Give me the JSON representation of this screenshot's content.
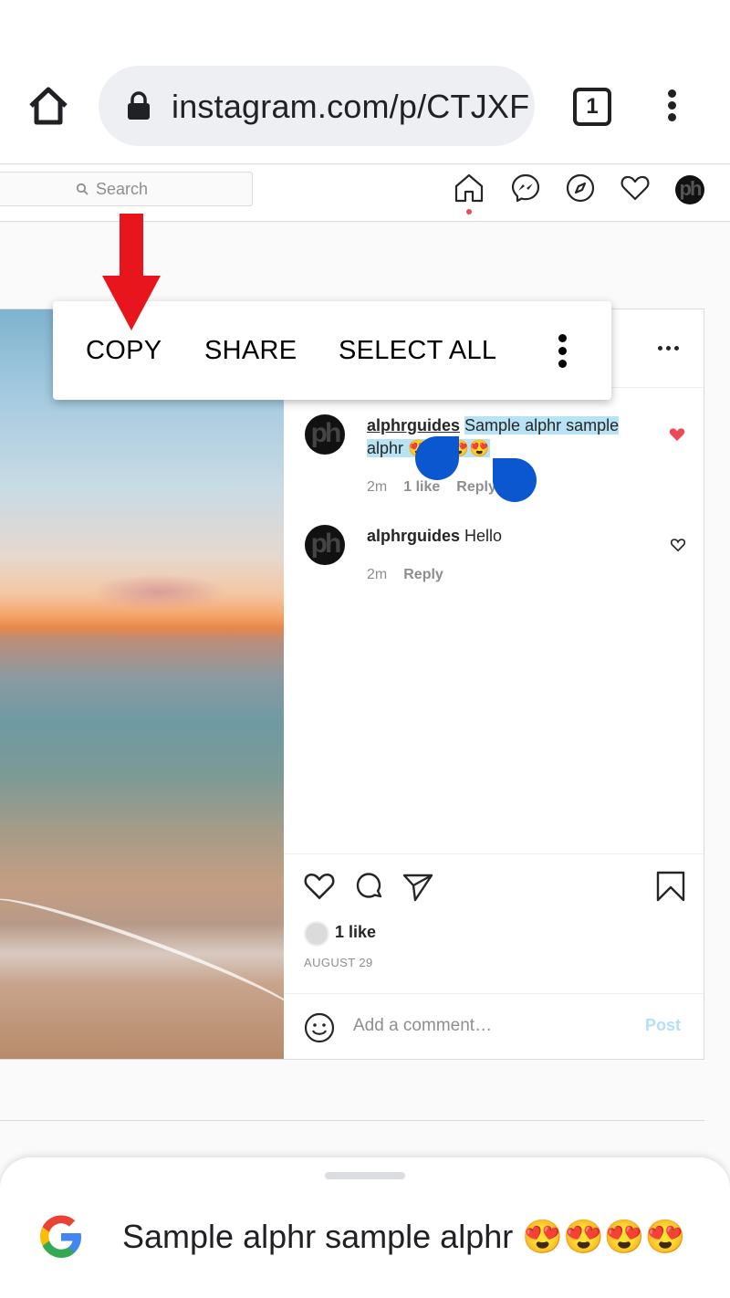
{
  "browser": {
    "url": "instagram.com/p/CTJXF",
    "tab_count": "1"
  },
  "ig_nav": {
    "search_placeholder": "Search",
    "avatar_text": "ph"
  },
  "context_menu": {
    "copy": "COPY",
    "share": "SHARE",
    "select_all": "SELECT ALL"
  },
  "comments": [
    {
      "avatar_text": "ph",
      "username": "alphrguides",
      "text_line1": "Sample alphr sample",
      "text_line2": "alphr 😍😍😍😍",
      "time": "2m",
      "likes": "1 like",
      "reply": "Reply",
      "liked": true
    },
    {
      "avatar_text": "ph",
      "username": "alphrguides",
      "text": "Hello",
      "time": "2m",
      "reply": "Reply",
      "liked": false
    }
  ],
  "post": {
    "likes": "1 like",
    "date": "AUGUST 29",
    "comment_placeholder": "Add a comment…",
    "post_button": "Post"
  },
  "bottom_sheet": {
    "text": "Sample alphr sample alphr 😍😍😍😍"
  },
  "colors": {
    "selection": "#b7e3f4",
    "handle": "#0b57d0",
    "like_red": "#ed4956",
    "post_button": "#b2dffc",
    "annotation_arrow": "#e8161c"
  }
}
